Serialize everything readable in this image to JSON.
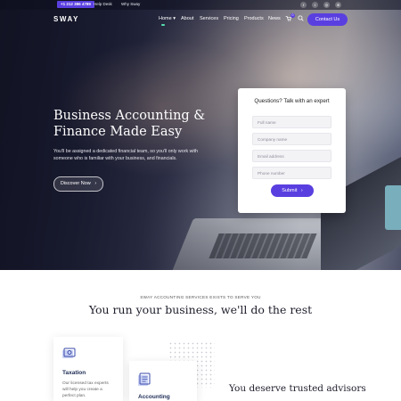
{
  "topbar": {
    "phone": "+1 212 386 4789",
    "links": [
      "Help Desk",
      "Why Sway"
    ],
    "social_icons": [
      "facebook-icon",
      "twitter-icon",
      "instagram-icon",
      "dribbble-icon"
    ]
  },
  "header": {
    "logo": "SWAY",
    "nav": [
      {
        "label": "Home ▾",
        "active": true
      },
      {
        "label": "About"
      },
      {
        "label": "Services"
      },
      {
        "label": "Pricing"
      },
      {
        "label": "Products"
      },
      {
        "label": "News"
      }
    ],
    "cart_count": "0",
    "contact_label": "Contact Us",
    "accent_color": "#5a3fe0"
  },
  "hero": {
    "title": "Business Accounting & Finance Made Easy",
    "subtitle": "You'll be assigned a dedicated financial team, so you'll only work with someone who is familiar with your business, and financials.",
    "button_label": "Discover Now"
  },
  "form": {
    "title": "Questions? Talk with an expert",
    "fields": [
      {
        "placeholder": "Full name"
      },
      {
        "placeholder": "Company name"
      },
      {
        "placeholder": "Email address"
      },
      {
        "placeholder": "Phone number"
      }
    ],
    "submit_label": "Submit"
  },
  "section": {
    "eyebrow": "SWAY ACCOUNTING SERVICES EXISTS TO SERVE YOU",
    "title": "You run your business, we'll do the rest",
    "cards": [
      {
        "title": "Taxation",
        "text": "Our licensed tax experts will help you create a perfect plan."
      },
      {
        "title": "Accounting"
      }
    ],
    "trusted_heading": "You deserve trusted advisors"
  }
}
